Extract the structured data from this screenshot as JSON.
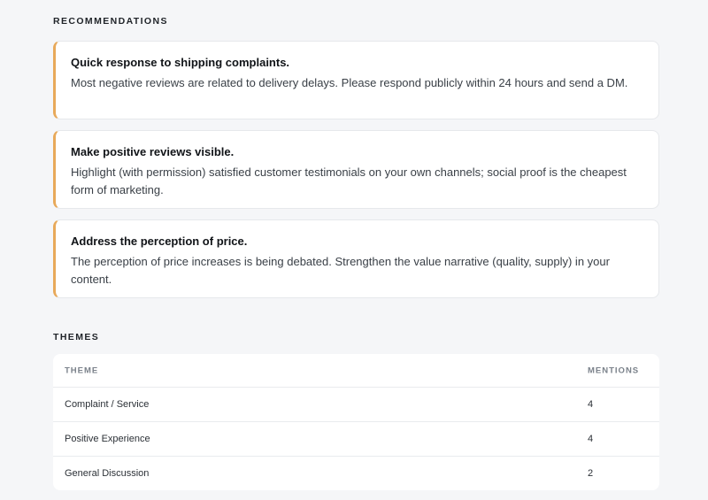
{
  "recommendations": {
    "title": "RECOMMENDATIONS",
    "items": [
      {
        "heading": "Quick response to shipping complaints.",
        "body": "Most negative reviews are related to delivery delays. Please respond publicly within 24 hours and send a DM."
      },
      {
        "heading": "Make positive reviews visible.",
        "body": "Highlight (with permission) satisfied customer testimonials on your own channels; social proof is the cheapest form of marketing."
      },
      {
        "heading": "Address the perception of price.",
        "body": "The perception of price increases is being debated. Strengthen the value narrative (quality, supply) in your content."
      }
    ]
  },
  "themes": {
    "title": "THEMES",
    "columns": {
      "theme": "THEME",
      "mentions": "MENTIONS"
    },
    "rows": [
      {
        "theme": "Complaint / Service",
        "mentions": "4"
      },
      {
        "theme": "Positive Experience",
        "mentions": "4"
      },
      {
        "theme": "General Discussion",
        "mentions": "2"
      }
    ]
  },
  "colors": {
    "accent": "#e8a95a",
    "background": "#f5f6f8",
    "card": "#ffffff"
  }
}
